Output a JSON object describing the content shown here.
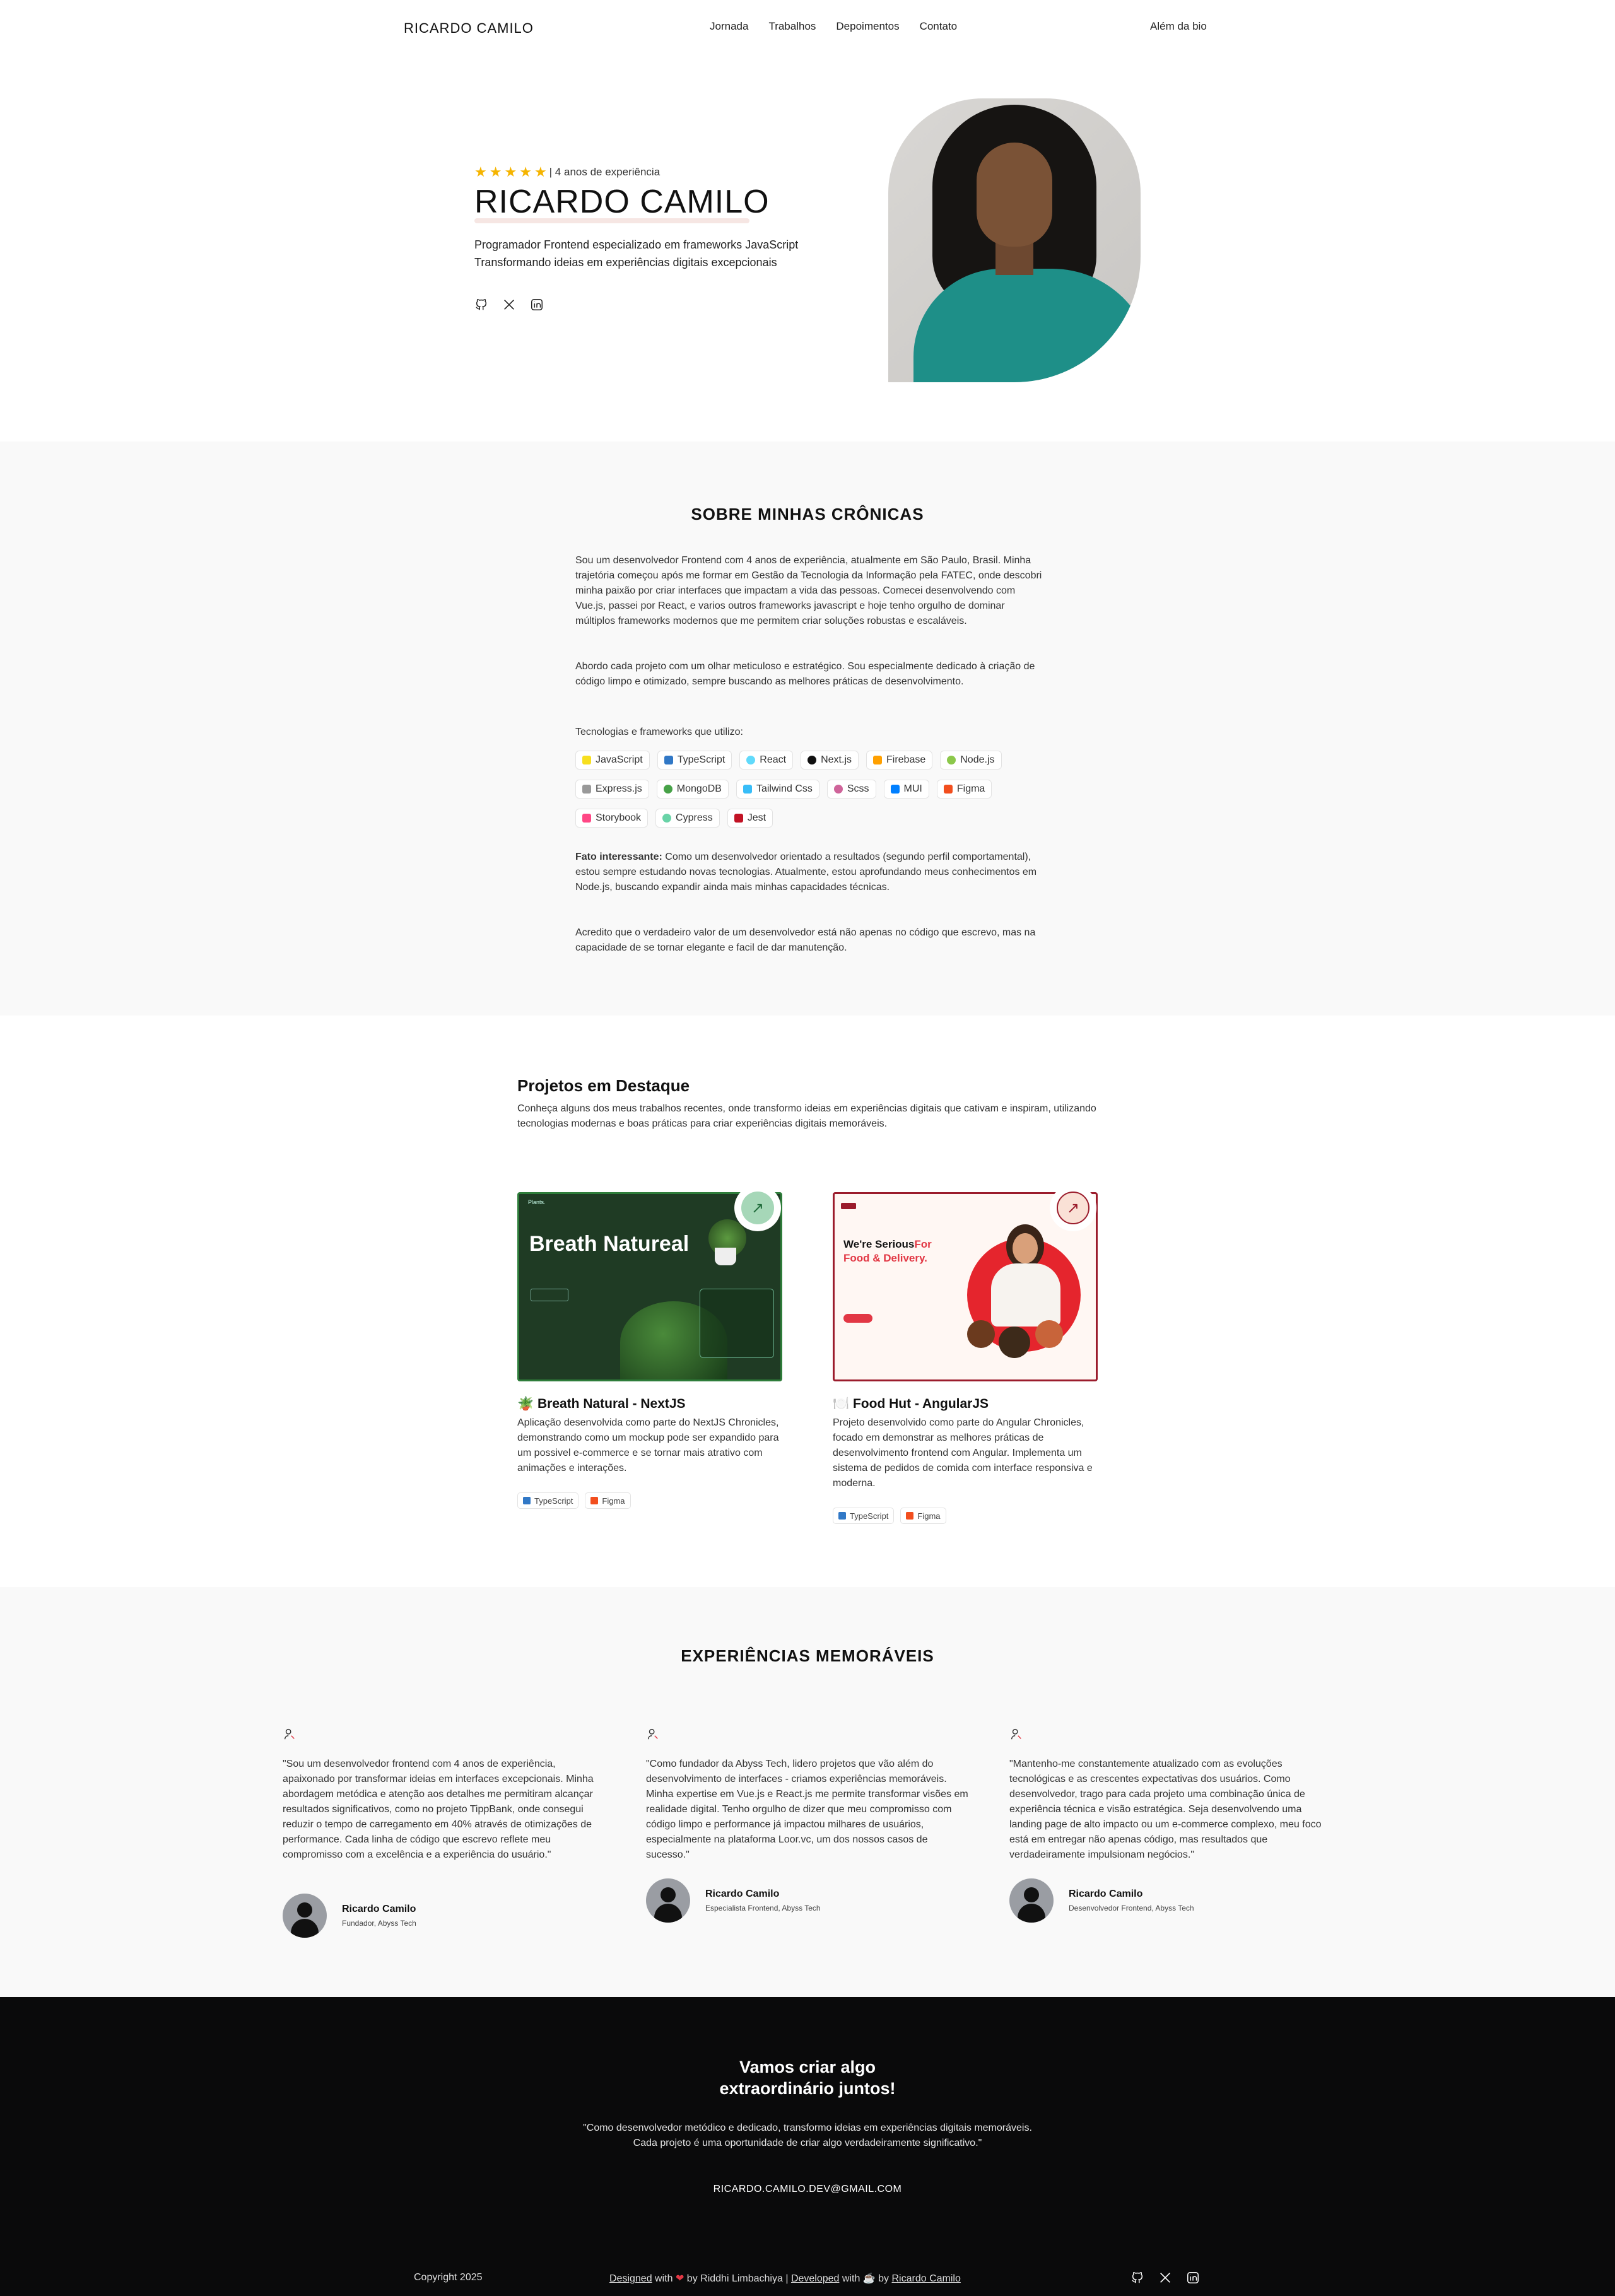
{
  "nav": {
    "brand": "RICARDO CAMILO",
    "items": [
      "Jornada",
      "Trabalhos",
      "Depoimentos",
      "Contato"
    ],
    "right_link": "Além da bio"
  },
  "hero": {
    "stars": 5,
    "experience": "| 4 anos de experiência",
    "name": "RICARDO CAMILO",
    "line1": "Programador Frontend especializado em frameworks JavaScript",
    "line2": "Transformando ideias em experiências digitais excepcionais",
    "social": [
      "github-icon",
      "x-icon",
      "linkedin-icon"
    ]
  },
  "about": {
    "title": "SOBRE MINHAS CRÔNICAS",
    "p1": "Sou um desenvolvedor Frontend com 4 anos de experiência, atualmente em São Paulo, Brasil. Minha trajetória começou após me formar em Gestão da Tecnologia da Informação pela FATEC, onde descobri minha paixão por criar interfaces que impactam a vida das pessoas. Comecei desenvolvendo com Vue.js, passei por React, e varios outros frameworks javascript e hoje tenho orgulho de dominar múltiplos frameworks modernos que me permitem criar soluções robustas e escaláveis.",
    "p2": "Abordo cada projeto com um olhar meticuloso e estratégico. Sou especialmente dedicado à criação de código limpo e otimizado, sempre buscando as melhores práticas de desenvolvimento.",
    "tech_label": "Tecnologias e frameworks que utilizo:",
    "tech_rows": [
      [
        {
          "label": "JavaScript",
          "color": "#f7df1e"
        },
        {
          "label": "TypeScript",
          "color": "#3178c6"
        },
        {
          "label": "React",
          "color": "#61dafb"
        },
        {
          "label": "Next.js",
          "color": "#111111"
        },
        {
          "label": "Firebase",
          "color": "#ffa000"
        },
        {
          "label": "Node.js",
          "color": "#8cc84b"
        }
      ],
      [
        {
          "label": "Express.js",
          "color": "#999999"
        },
        {
          "label": "MongoDB",
          "color": "#47a248"
        },
        {
          "label": "Tailwind Css",
          "color": "#38bdf8"
        },
        {
          "label": "Scss",
          "color": "#cf649a"
        },
        {
          "label": "MUI",
          "color": "#007fff"
        },
        {
          "label": "Figma",
          "color": "#f24e1e"
        }
      ],
      [
        {
          "label": "Storybook",
          "color": "#ff4785"
        },
        {
          "label": "Cypress",
          "color": "#69d3a7"
        },
        {
          "label": "Jest",
          "color": "#c21325"
        }
      ]
    ],
    "fact_bold": "Fato interessante:",
    "fact": " Como um desenvolvedor orientado a resultados (segundo perfil comportamental), estou sempre estudando novas tecnologias. Atualmente, estou aprofundando meus conhecimentos em Node.js, buscando expandir ainda mais minhas capacidades técnicas.",
    "p3": "Acredito que o verdadeiro valor de um desenvolvedor está não apenas no código que escrevo, mas na capacidade de se tornar elegante e facil de dar manutenção."
  },
  "projects": {
    "title": "Projetos em Destaque",
    "subtitle": "Conheça alguns dos meus trabalhos recentes, onde transformo ideias em experiências digitais que cativam e inspiram, utilizando tecnologias modernas e boas práticas para criar experiências digitais memoráveis.",
    "cards": [
      {
        "title": "🪴 Breath Natural - NextJS",
        "desc": "Aplicação desenvolvida como parte do NextJS Chronicles, demonstrando como um mockup pode ser expandido para um possivel e-commerce e se tornar mais atrativo com animações e interações.",
        "tags": [
          {
            "label": "TypeScript",
            "color": "#3178c6"
          },
          {
            "label": "Figma",
            "color": "#f24e1e"
          }
        ],
        "preview": {
          "headline": "Breath Natureal",
          "brand": "Plants."
        }
      },
      {
        "title": "🍽️ Food Hut - AngularJS",
        "desc": "Projeto desenvolvido como parte do Angular Chronicles, focado em demonstrar as melhores práticas de desenvolvimento frontend com Angular. Implementa um sistema de pedidos de comida com interface responsiva e moderna.",
        "tags": [
          {
            "label": "TypeScript",
            "color": "#3178c6"
          },
          {
            "label": "Figma",
            "color": "#f24e1e"
          }
        ],
        "preview": {
          "headline1": "We're Serious",
          "headline2": "For",
          "headline3": "Food & Delivery."
        }
      }
    ]
  },
  "experiences": {
    "title": "EXPERIÊNCIAS MEMORÁVEIS",
    "items": [
      {
        "quote": "\"Sou um desenvolvedor frontend com 4 anos de experiência, apaixonado por transformar ideias em interfaces excepcionais. Minha abordagem metódica e atenção aos detalhes me permitiram alcançar resultados significativos, como no projeto TippBank, onde consegui reduzir o tempo de carregamento em 40% através de otimizações de performance. Cada linha de código que escrevo reflete meu compromisso com a excelência e a experiência do usuário.\"",
        "name": "Ricardo Camilo",
        "role": "Fundador, Abyss Tech"
      },
      {
        "quote": "\"Como fundador da Abyss Tech, lidero projetos que vão além do desenvolvimento de interfaces - criamos experiências memoráveis. Minha expertise em Vue.js e React.js me permite transformar visões em realidade digital. Tenho orgulho de dizer que meu compromisso com código limpo e performance já impactou milhares de usuários, especialmente na plataforma Loor.vc, um dos nossos casos de sucesso.\"",
        "name": "Ricardo Camilo",
        "role": "Especialista Frontend, Abyss Tech"
      },
      {
        "quote": "\"Mantenho-me constantemente atualizado com as evoluções tecnológicas e as crescentes expectativas dos usuários. Como desenvolvedor, trago para cada projeto uma combinação única de experiência técnica e visão estratégica. Seja desenvolvendo uma landing page de alto impacto ou um e-commerce complexo, meu foco está em entregar não apenas código, mas resultados que verdadeiramente impulsionam negócios.\"",
        "name": "Ricardo Camilo",
        "role": "Desenvolvedor Frontend, Abyss Tech"
      }
    ]
  },
  "footer": {
    "cta_line1": "Vamos criar algo",
    "cta_line2": "extraordinário juntos!",
    "quote": "\"Como desenvolvedor metódico e dedicado, transformo ideias em experiências digitais memoráveis. Cada projeto é uma oportunidade de criar algo verdadeiramente significativo.\"",
    "email": "RICARDO.CAMILO.DEV@GMAIL.COM",
    "copyright": "Copyright 2025",
    "designed": "Designed",
    "with1": " with ",
    "by1": " by Riddhi Limbachiya | ",
    "developed": "Developed",
    "with2": " with ",
    "by2": " by ",
    "dev_name": "Ricardo Camilo"
  }
}
